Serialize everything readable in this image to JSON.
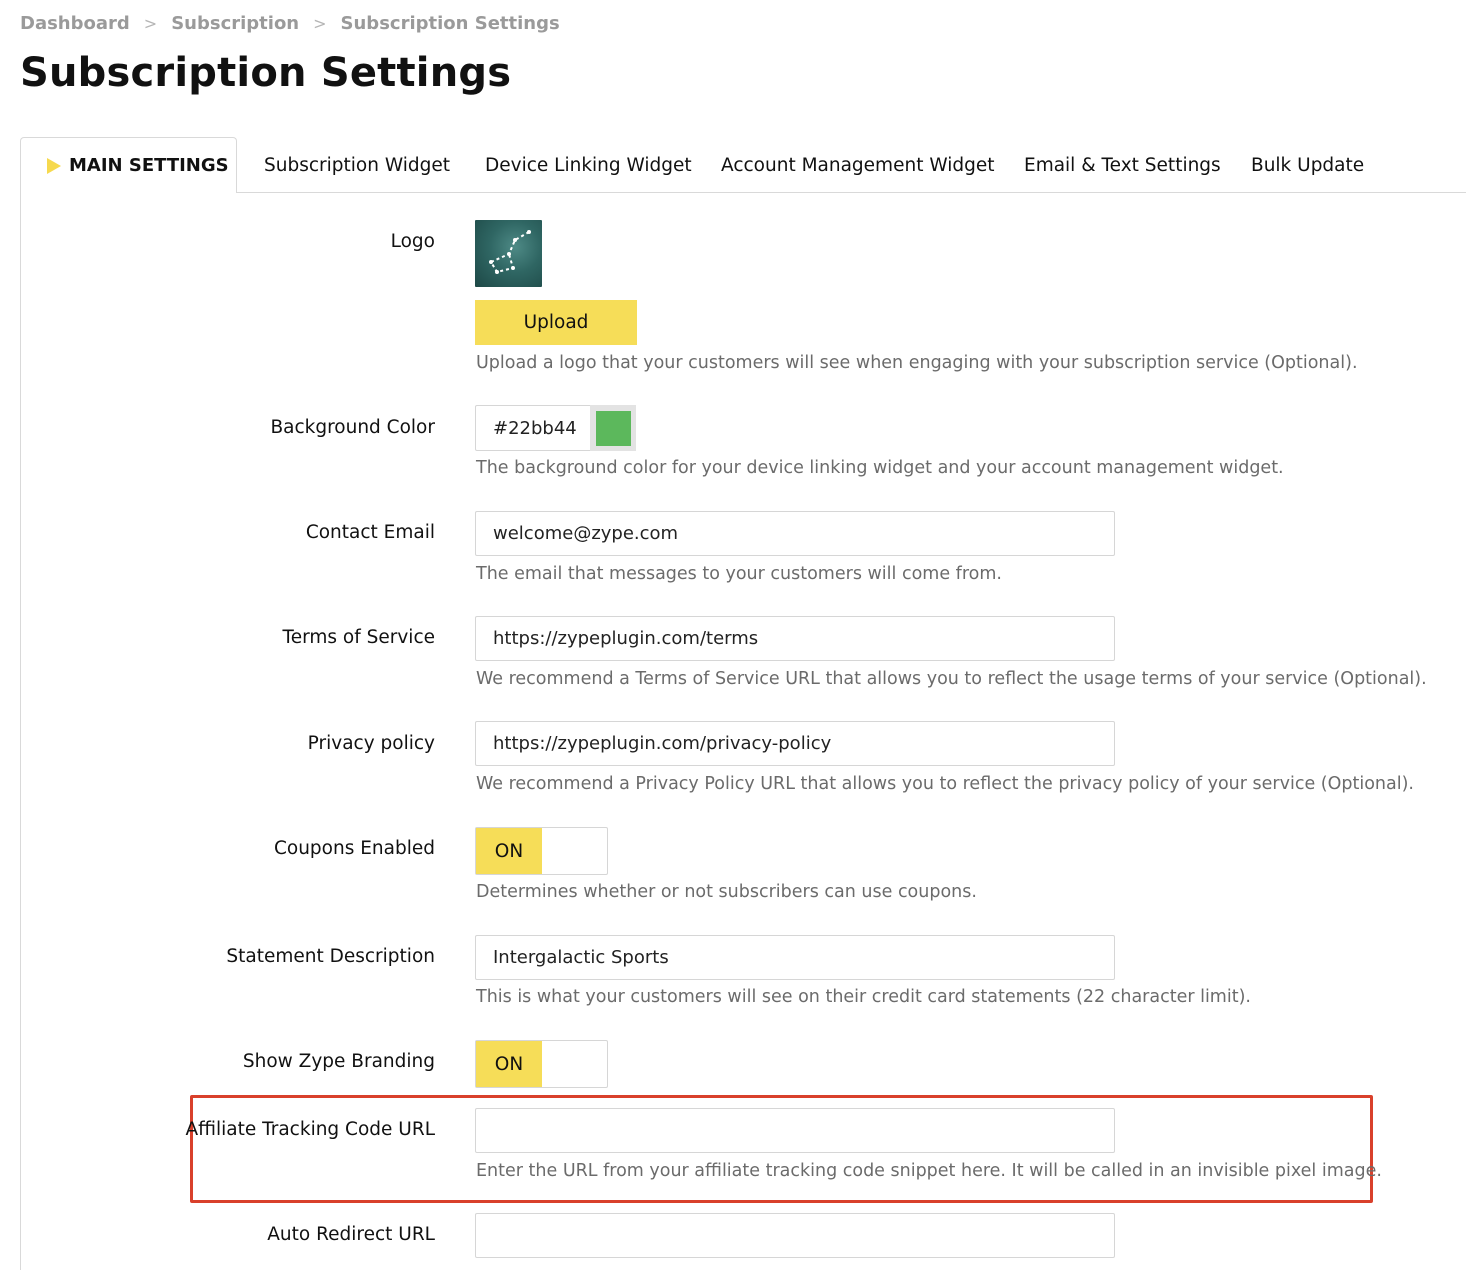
{
  "breadcrumb": {
    "items": [
      "Dashboard",
      "Subscription",
      "Subscription Settings"
    ]
  },
  "page": {
    "title": "Subscription Settings"
  },
  "tabs": [
    {
      "label": "MAIN SETTINGS"
    },
    {
      "label": "Subscription Widget"
    },
    {
      "label": "Device Linking Widget"
    },
    {
      "label": "Account Management Widget"
    },
    {
      "label": "Email & Text Settings"
    },
    {
      "label": "Bulk Update"
    }
  ],
  "form": {
    "logo": {
      "label": "Logo",
      "button": "Upload",
      "help": "Upload a logo that your customers will see when engaging with your subscription service (Optional)."
    },
    "background_color": {
      "label": "Background Color",
      "value": "#22bb44",
      "swatch_color": "#5cb85c",
      "help": "The background color for your device linking widget and your account management widget."
    },
    "contact_email": {
      "label": "Contact Email",
      "value": "welcome@zype.com",
      "help": "The email that messages to your customers will come from."
    },
    "terms": {
      "label": "Terms of Service",
      "value": "https://zypeplugin.com/terms",
      "help": "We recommend a Terms of Service URL that allows you to reflect the usage terms of your service (Optional)."
    },
    "privacy": {
      "label": "Privacy policy",
      "value": "https://zypeplugin.com/privacy-policy",
      "help": "We recommend a Privacy Policy URL that allows you to reflect the privacy policy of your service (Optional)."
    },
    "coupons": {
      "label": "Coupons Enabled",
      "state": "ON",
      "help": "Determines whether or not subscribers can use coupons."
    },
    "statement": {
      "label": "Statement Description",
      "value": "Intergalactic Sports",
      "help": "This is what your customers will see on their credit card statements (22 character limit)."
    },
    "branding": {
      "label": "Show Zype Branding",
      "state": "ON"
    },
    "affiliate": {
      "label": "Affiliate Tracking Code URL",
      "value": "",
      "help": "Enter the URL from your affiliate tracking code snippet here. It will be called in an invisible pixel image."
    },
    "redirect": {
      "label": "Auto Redirect URL",
      "value": ""
    }
  },
  "colors": {
    "accent": "#f6dd58",
    "highlight_border": "#d9402b"
  }
}
